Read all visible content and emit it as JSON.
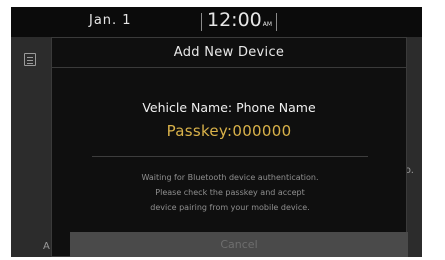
{
  "status_bar": {
    "date": "Jan.  1",
    "time": "12:00",
    "ampm": "AM"
  },
  "background": {
    "right_text": "uto.",
    "left_text": "A"
  },
  "dialog": {
    "title": "Add New Device",
    "vehicle_name": "Vehicle Name: Phone Name",
    "passkey": "Passkey:000000",
    "message_lines": [
      "Waiting for Bluetooth device authentication.",
      "Please check the passkey and accept",
      "device pairing from your mobile device."
    ],
    "cancel_label": "Cancel"
  },
  "colors": {
    "passkey": "#d9b24a",
    "dialog_bg": "#0f0f0f",
    "screen_bg": "#2c2c2c"
  }
}
